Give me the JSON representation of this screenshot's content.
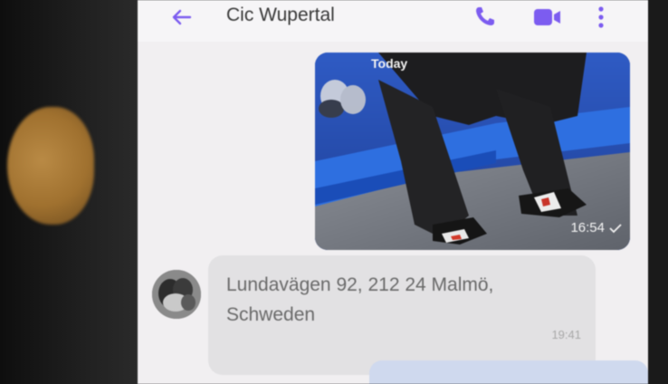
{
  "header": {
    "contact_name": "Cic Wupertal",
    "icons": [
      "back-arrow-icon",
      "phone-call-icon",
      "video-call-icon",
      "more-menu-icon"
    ]
  },
  "chat": {
    "date_separator": "Today",
    "photo_message": {
      "time": "16:54"
    },
    "incoming_message": {
      "line1": "Lundavägen 92, 212 24 Malmö,",
      "line2": "Schweden",
      "time": "19:41"
    }
  },
  "colors": {
    "accent": "#7c5cf0",
    "incoming_bubble": "#e2e1e3",
    "outgoing_bubble": "#cfd9ee",
    "chat_background": "#f1eff1"
  }
}
